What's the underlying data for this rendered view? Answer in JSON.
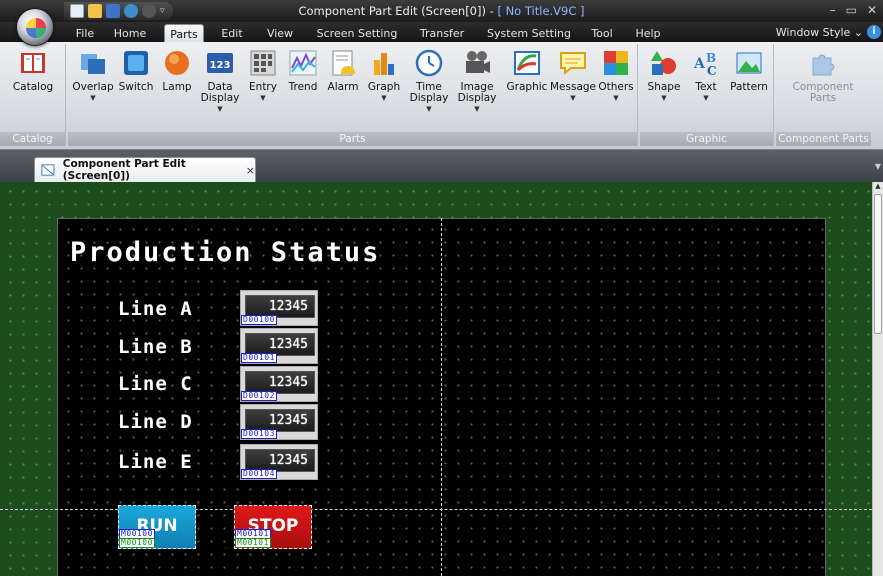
{
  "window": {
    "title_prefix": "Component Part Edit (Screen[0]) - ",
    "title_doc": "[ No Title.V9C ]",
    "minimize": "–",
    "restore": "▭",
    "close": "✕"
  },
  "menu": {
    "tabs": [
      "File",
      "Home",
      "Parts",
      "Edit",
      "View",
      "Screen Setting",
      "Transfer",
      "System Setting",
      "Tool",
      "Help"
    ],
    "active": "Parts",
    "window_style": "Window Style",
    "window_style_arrow": "⌄",
    "help": "i"
  },
  "ribbon": {
    "groups": {
      "catalog": "Catalog",
      "parts": "Parts",
      "graphic": "Graphic",
      "component_parts": "Component Parts"
    },
    "buttons": {
      "catalog": "Catalog",
      "overlap": "Overlap",
      "switch": "Switch",
      "lamp": "Lamp",
      "data_display": "Data Display",
      "entry": "Entry",
      "trend": "Trend",
      "alarm": "Alarm",
      "graph": "Graph",
      "time_display": "Time Display",
      "image_display": "Image Display",
      "graphic": "Graphic",
      "message": "Message",
      "others": "Others",
      "shape": "Shape",
      "text": "Text",
      "pattern": "Pattern",
      "component_parts": "Component Parts"
    },
    "data_display_icon": "123"
  },
  "doc_tab": {
    "label": "Component Part Edit (Screen[0])",
    "close": "×"
  },
  "screen": {
    "title": "Production Status",
    "lines": [
      {
        "label": "Line A",
        "value": "12345",
        "address": "D00100"
      },
      {
        "label": "Line B",
        "value": "12345",
        "address": "D00101"
      },
      {
        "label": "Line C",
        "value": "12345",
        "address": "D00102"
      },
      {
        "label": "Line D",
        "value": "12345",
        "address": "D00103"
      },
      {
        "label": "Line E",
        "value": "12345",
        "address": "D00104"
      }
    ],
    "switches": [
      {
        "label": "RUN",
        "addr1": "M00100",
        "addr2": "M00100",
        "color": "#1ba7dd"
      },
      {
        "label": "STOP",
        "addr1": "M00101",
        "addr2": "M00101",
        "color": "#e01818"
      }
    ]
  }
}
